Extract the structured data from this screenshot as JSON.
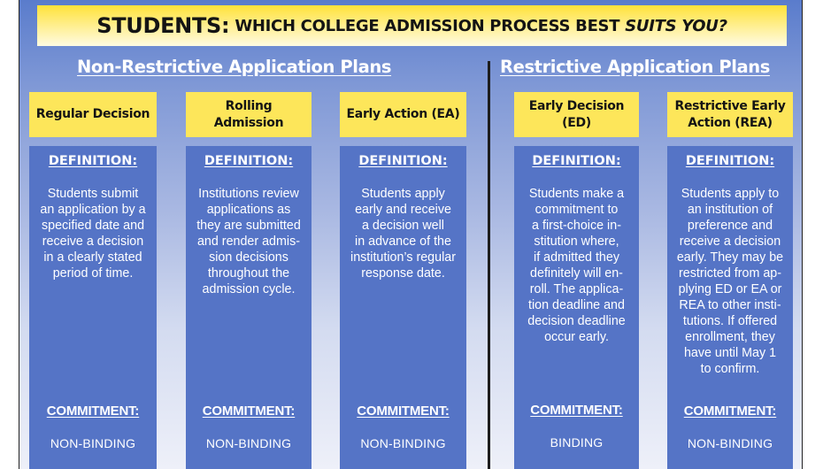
{
  "banner": {
    "part1": "STUDENTS:",
    "part2": "WHICH COLLEGE ADMISSION PROCESS BEST",
    "part3": "SUITS YOU?"
  },
  "sections": {
    "non_restrictive": "Non-Restrictive Application Plans",
    "restrictive": "Restrictive Application Plans"
  },
  "labels": {
    "definition": "DEFINITION:",
    "commitment": "COMMITMENT:"
  },
  "plans": [
    {
      "name": "Regular Decision",
      "definition": "Students submit\nan application by a\nspecified date and\nreceive a decision\nin a clearly stated\nperiod of time.",
      "commitment": "NON-BINDING"
    },
    {
      "name": "Rolling\nAdmission",
      "definition": "Institutions review\napplications as\nthey are submitted\nand render admis-\nsion decisions\nthroughout the\nadmission cycle.",
      "commitment": "NON-BINDING"
    },
    {
      "name": "Early Action (EA)",
      "definition": "Students apply\nearly and receive\na decision well\nin advance of the\ninstitution’s regular\nresponse date.",
      "commitment": "NON-BINDING"
    },
    {
      "name": "Early Decision\n(ED)",
      "definition": "Students make a\ncommitment to\na first-choice in-\nstitution where,\nif admitted they\ndefinitely will en-\nroll. The applica-\ntion deadline and\ndecision deadline\noccur early.",
      "commitment": "BINDING"
    },
    {
      "name": "Restrictive Early\nAction (REA)",
      "definition": "Students apply to\nan institution of\npreference and\nreceive a decision\nearly. They may be\nrestricted from ap-\nplying ED or EA or\nREA to other insti-\ntutions. If offered\nenrollment, they\nhave until May 1\nto confirm.",
      "commitment": "NON-BINDING"
    }
  ]
}
